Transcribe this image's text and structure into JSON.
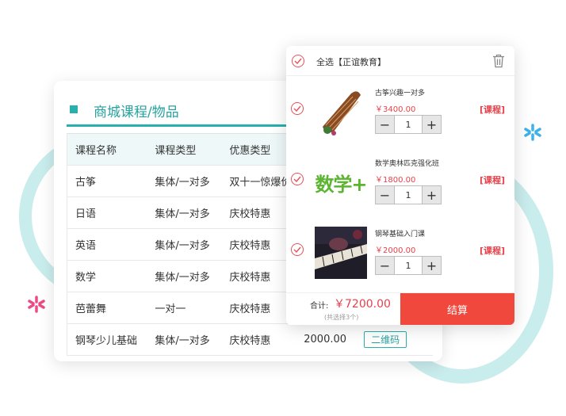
{
  "course_panel": {
    "title": "商城课程/物品",
    "columns": [
      "课程名称",
      "课程类型",
      "优惠类型"
    ],
    "rows": [
      {
        "name": "古筝",
        "type": "集体/一对多",
        "promo": "双十一惊爆价"
      },
      {
        "name": "日语",
        "type": "集体/一对多",
        "promo": "庆校特惠"
      },
      {
        "name": "英语",
        "type": "集体/一对多",
        "promo": "庆校特惠"
      },
      {
        "name": "数学",
        "type": "集体/一对多",
        "promo": "庆校特惠"
      },
      {
        "name": "芭蕾舞",
        "type": "一对一",
        "promo": "庆校特惠"
      },
      {
        "name": "钢琴少儿基础",
        "type": "集体/一对多",
        "promo": "庆校特惠",
        "price": "2000.00",
        "action": "二维码"
      }
    ]
  },
  "cart": {
    "select_all": "全选【正谊教育】",
    "items": [
      {
        "name": "古筝兴趣一对多",
        "price": "￥3400.00",
        "qty": "1",
        "tag": "[课程]"
      },
      {
        "name": "数学奥林匹克强化班",
        "price": "￥1800.00",
        "qty": "1",
        "tag": "[课程]",
        "thumb_text": "数学+"
      },
      {
        "name": "钢琴基础入门课",
        "price": "￥2000.00",
        "qty": "1",
        "tag": "[课程]"
      }
    ],
    "total_label": "合计:",
    "total_value": "￥7200.00",
    "selected_count": "(共选择3个)",
    "checkout_label": "结算"
  },
  "colors": {
    "teal": "#27b0ad",
    "red": "#e8404a",
    "checkout": "#f0483c"
  },
  "icons": {
    "trash": "trash-icon",
    "check": "check-circle-icon",
    "minus": "minus-icon",
    "plus": "plus-icon"
  }
}
